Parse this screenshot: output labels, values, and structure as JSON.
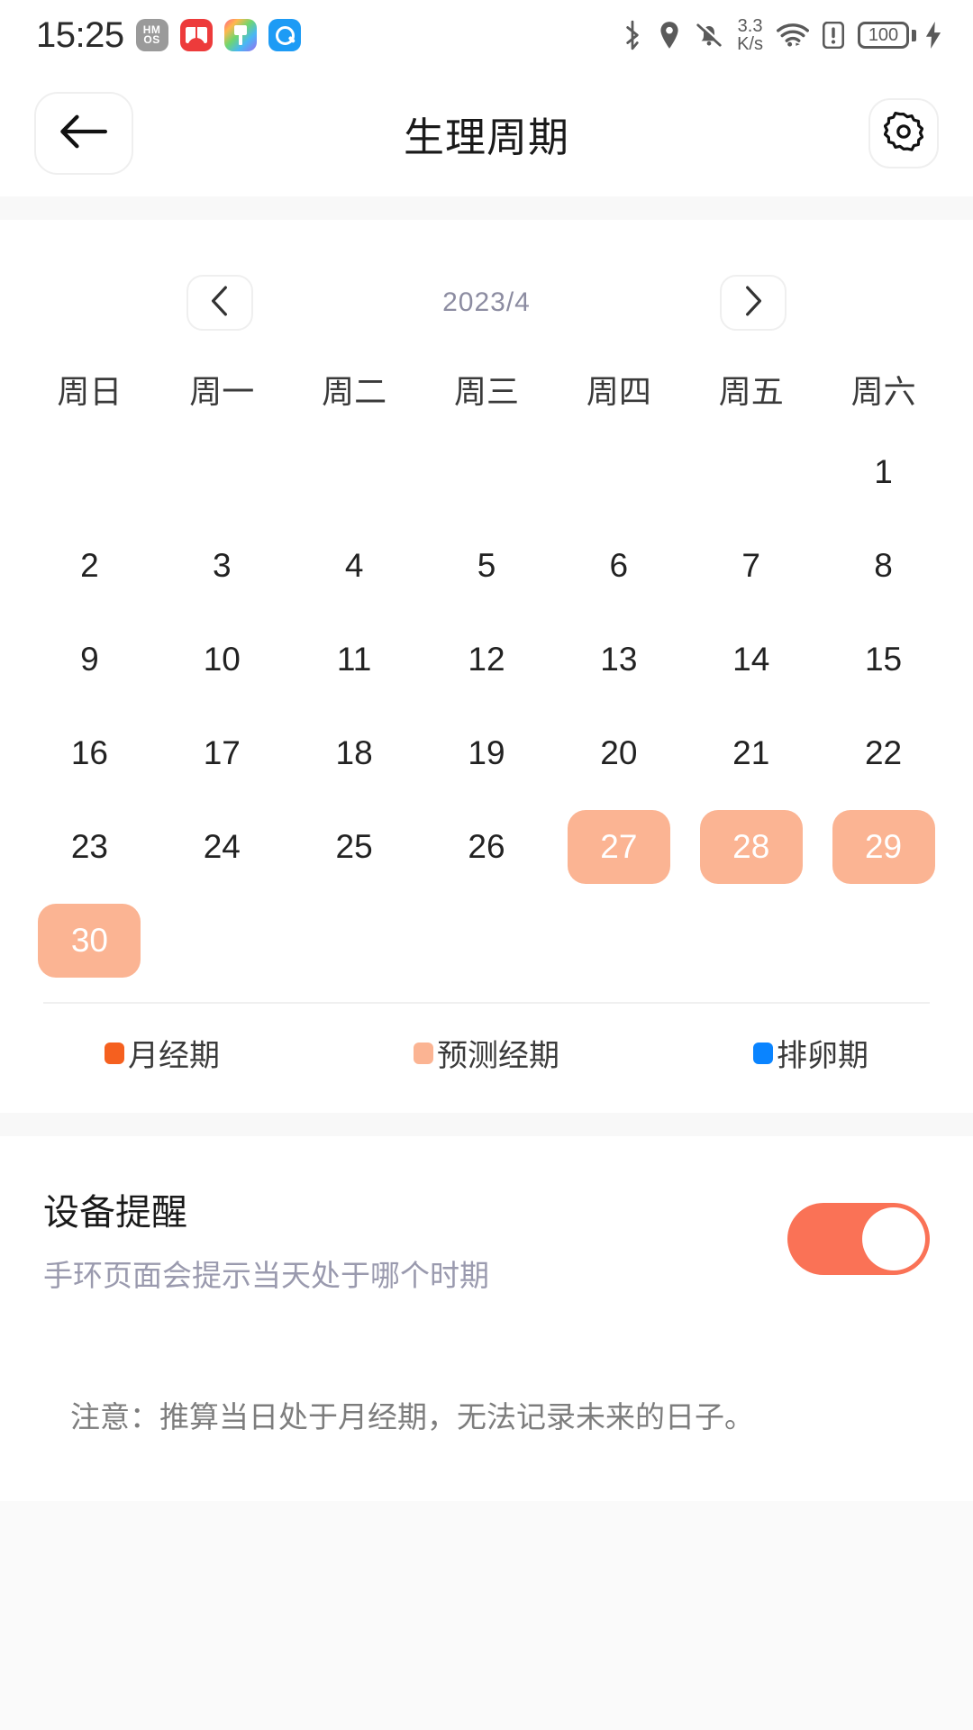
{
  "status_bar": {
    "time": "15:25",
    "app_icons": [
      {
        "name": "hmos-badge-icon",
        "label": "HM\nOS"
      },
      {
        "name": "book-app-icon",
        "label": ""
      },
      {
        "name": "brush-app-icon",
        "label": ""
      },
      {
        "name": "search-app-icon",
        "label": ""
      }
    ],
    "bluetooth_icon": "bluetooth-icon",
    "location_icon": "location-pin-icon",
    "mute_icon": "bell-muted-icon",
    "network_speed_value": "3.3",
    "network_speed_unit": "K/s",
    "wifi_icon": "wifi-icon",
    "alert_icon": "alert-icon",
    "battery_level": "100",
    "charging_icon": "charging-bolt-icon"
  },
  "nav": {
    "back_icon": "back-arrow-icon",
    "title": "生理周期",
    "settings_icon": "gear-icon"
  },
  "calendar": {
    "prev_icon": "chevron-left-icon",
    "next_icon": "chevron-right-icon",
    "month_label": "2023/4",
    "weekdays": [
      "周日",
      "周一",
      "周二",
      "周三",
      "周四",
      "周五",
      "周六"
    ],
    "weeks": [
      [
        {
          "day": "",
          "state": "empty"
        },
        {
          "day": "",
          "state": "empty"
        },
        {
          "day": "",
          "state": "empty"
        },
        {
          "day": "",
          "state": "empty"
        },
        {
          "day": "",
          "state": "empty"
        },
        {
          "day": "",
          "state": "empty"
        },
        {
          "day": "1",
          "state": "normal"
        }
      ],
      [
        {
          "day": "2",
          "state": "normal"
        },
        {
          "day": "3",
          "state": "normal"
        },
        {
          "day": "4",
          "state": "normal"
        },
        {
          "day": "5",
          "state": "normal"
        },
        {
          "day": "6",
          "state": "normal"
        },
        {
          "day": "7",
          "state": "normal"
        },
        {
          "day": "8",
          "state": "normal"
        }
      ],
      [
        {
          "day": "9",
          "state": "normal"
        },
        {
          "day": "10",
          "state": "normal"
        },
        {
          "day": "11",
          "state": "normal"
        },
        {
          "day": "12",
          "state": "normal"
        },
        {
          "day": "13",
          "state": "normal"
        },
        {
          "day": "14",
          "state": "normal"
        },
        {
          "day": "15",
          "state": "normal"
        }
      ],
      [
        {
          "day": "16",
          "state": "normal"
        },
        {
          "day": "17",
          "state": "normal"
        },
        {
          "day": "18",
          "state": "normal"
        },
        {
          "day": "19",
          "state": "normal"
        },
        {
          "day": "20",
          "state": "normal"
        },
        {
          "day": "21",
          "state": "normal"
        },
        {
          "day": "22",
          "state": "normal"
        }
      ],
      [
        {
          "day": "23",
          "state": "normal"
        },
        {
          "day": "24",
          "state": "normal"
        },
        {
          "day": "25",
          "state": "normal"
        },
        {
          "day": "26",
          "state": "normal"
        },
        {
          "day": "27",
          "state": "predicted"
        },
        {
          "day": "28",
          "state": "predicted"
        },
        {
          "day": "29",
          "state": "predicted"
        }
      ],
      [
        {
          "day": "30",
          "state": "predicted"
        },
        {
          "day": "",
          "state": "empty"
        },
        {
          "day": "",
          "state": "empty"
        },
        {
          "day": "",
          "state": "empty"
        },
        {
          "day": "",
          "state": "empty"
        },
        {
          "day": "",
          "state": "empty"
        },
        {
          "day": "",
          "state": "empty"
        }
      ]
    ],
    "legend": [
      {
        "label": "月经期",
        "color": "#F5601F"
      },
      {
        "label": "预测经期",
        "color": "#FBB493"
      },
      {
        "label": "排卵期",
        "color": "#0A84FF"
      }
    ]
  },
  "reminder": {
    "title": "设备提醒",
    "subtitle": "手环页面会提示当天处于哪个时期",
    "toggle_on": true,
    "toggle_color": "#FA7256"
  },
  "note": {
    "text": "注意：推算当日处于月经期，无法记录未来的日子。"
  }
}
